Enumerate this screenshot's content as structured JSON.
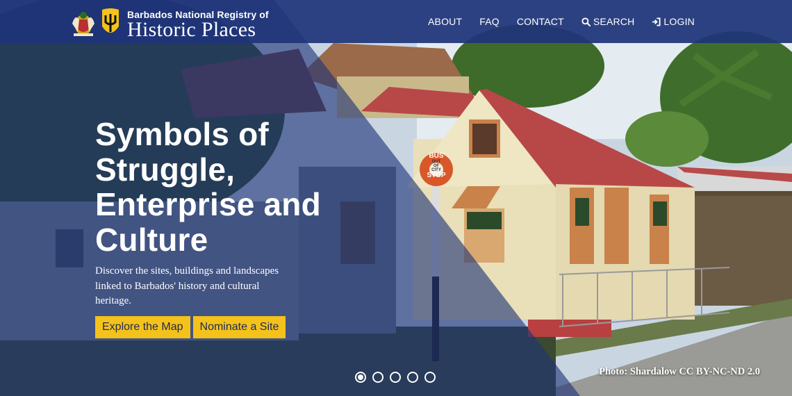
{
  "brand": {
    "line1": "Barbados National Registry of",
    "line2": "Historic Places"
  },
  "nav": {
    "items": [
      {
        "label": "ABOUT",
        "icon": ""
      },
      {
        "label": "FAQ",
        "icon": ""
      },
      {
        "label": "CONTACT",
        "icon": ""
      },
      {
        "label": "SEARCH",
        "icon": "search-icon"
      },
      {
        "label": "LOGIN",
        "icon": "login-icon"
      }
    ]
  },
  "hero": {
    "title_lines": [
      "Symbols of",
      "Struggle,",
      "Enterprise and",
      "Culture"
    ],
    "description": "Discover the sites, buildings and landscapes linked to Barbados' history and cultural heritage.",
    "buttons": [
      "Explore the Map",
      "Nominate a Site"
    ]
  },
  "carousel": {
    "total": 5,
    "active_index": 0
  },
  "photo": {
    "credit": "Photo: Shardalow CC BY-NC-ND 2.0",
    "sign_text": [
      "BUS",
      "OUT",
      "OF",
      "CITY",
      "STOP"
    ]
  },
  "colors": {
    "navbar": "#1e3478",
    "overlay": "#1e3478",
    "button_bg": "#f4c21a",
    "button_text": "#1e2a55"
  }
}
